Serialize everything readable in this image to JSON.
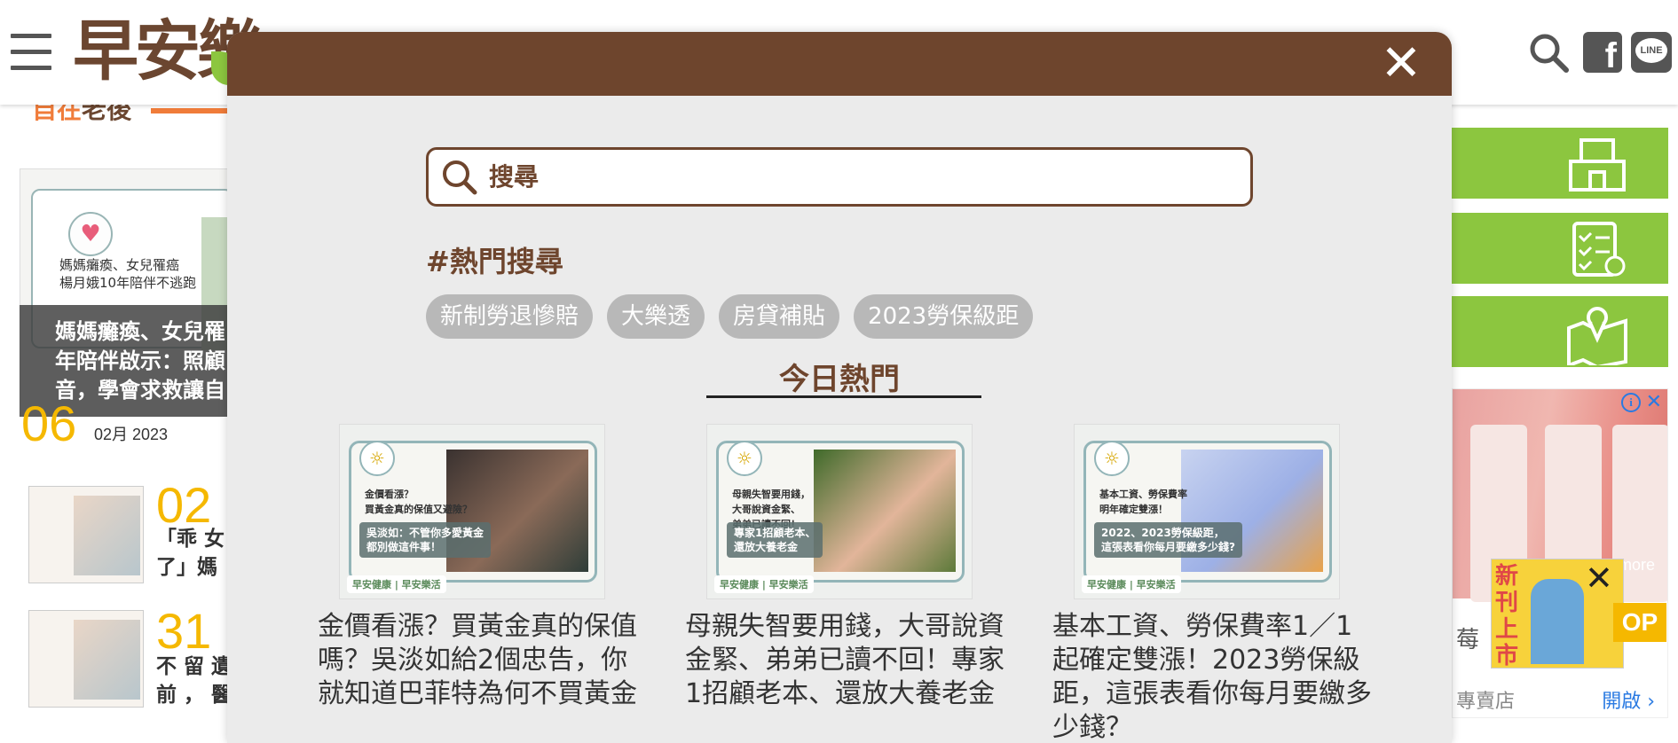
{
  "header": {
    "logo_text": "早安樂",
    "icons": [
      "menu-icon",
      "search-icon",
      "facebook-icon",
      "line-icon"
    ],
    "line_label": "LINE",
    "facebook_label": "f"
  },
  "background": {
    "section_title_accent": "自在",
    "section_title": "老後",
    "feature": {
      "image_text": "媽媽癱瘓、女兒罹癌\n楊月娥10年陪伴不逃跑",
      "overlay": "媽媽癱瘓、女兒罹\n年陪伴啟示：照顧\n音，學會求救讓自",
      "day": "06",
      "month_year": "02月 2023"
    },
    "list": [
      {
        "num": "02",
        "text": "「乖 女\n了」媽"
      },
      {
        "num": "31",
        "text": "不 留 遺\n前 ， 醫"
      }
    ]
  },
  "right": {
    "ad_brand": "8more",
    "ad_text": "莓",
    "ad_text2": "專賣店",
    "ad_open": "開啟",
    "mag_text": "新刊上市",
    "top_label": "OP"
  },
  "modal": {
    "search_placeholder": "搜尋",
    "hot_title": "#熱門搜尋",
    "tags": [
      "新制勞退慘賠",
      "大樂透",
      "房貸補貼",
      "2023勞保級距"
    ],
    "today_title": "今日熱門",
    "articles": [
      {
        "thumb_q": "金價看漲？\n買黃金真的保值又避險？",
        "thumb_cap": "吳淡如：不管你多愛黃金\n都別做這件事！",
        "title": "金價看漲？買黃金真的保值嗎？吳淡如給2個忠告，你就知道巴菲特為何不買黃金"
      },
      {
        "thumb_q": "母親失智要用錢，\n大哥說資金緊、\n弟弟已讀不回！",
        "thumb_cap": "專家1招顧老本、\n還放大養老金",
        "title": "母親失智要用錢，大哥說資金緊、弟弟已讀不回！專家1招顧老本、還放大養老金"
      },
      {
        "thumb_q": "基本工資、勞保費率\n明年確定雙漲！",
        "thumb_cap": "2022、2023勞保級距，\n這張表看你每月要繳多少錢?",
        "title": "基本工資、勞保費率1／1起確定雙漲！2023勞保級距，這張表看你每月要繳多少錢？"
      }
    ],
    "thumb_brand": "早安健康 | 早安樂活"
  },
  "colors": {
    "brown": "#6e452d",
    "green": "#8cc63f",
    "yellow": "#f5b800",
    "orange": "#f07c3a"
  }
}
